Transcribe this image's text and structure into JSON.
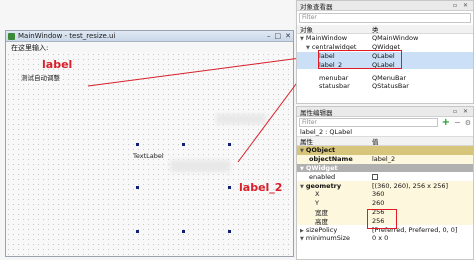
{
  "editor": {
    "window_title": "MainWindow - test_resize.ui",
    "menu_entry": "在这里输入:",
    "label_widget_text": "测试自动调整",
    "label2_widget_text": "TextLabel",
    "annotations": {
      "label": "label",
      "label_2": "label_2"
    },
    "annotation_color": "#d81f2a"
  },
  "object_inspector": {
    "title": "对象查看器",
    "filter_placeholder": "Filter",
    "columns": [
      "对象",
      "类"
    ],
    "rows": [
      {
        "object": "MainWindow",
        "class": "QMainWindow",
        "level": 0
      },
      {
        "object": "centralwidget",
        "class": "QWidget",
        "level": 1
      },
      {
        "object": "label",
        "class": "QLabel",
        "level": 2
      },
      {
        "object": "label_2",
        "class": "QLabel",
        "level": 2
      },
      {
        "object": "menubar",
        "class": "QMenuBar",
        "level": 1
      },
      {
        "object": "statusbar",
        "class": "QStatusBar",
        "level": 1
      }
    ]
  },
  "property_editor": {
    "title": "属性编辑器",
    "filter_placeholder": "Filter",
    "path": "label_2 : QLabel",
    "columns": [
      "属性",
      "值"
    ],
    "sections": {
      "qobject": "QObject",
      "qwidget": "QWidget"
    },
    "rows": {
      "objectName": {
        "name": "objectName",
        "value": "label_2"
      },
      "enabled": {
        "name": "enabled",
        "value": ""
      },
      "geometry": {
        "name": "geometry",
        "value": "[(360, 260), 256 x 256]"
      },
      "x": {
        "name": "X",
        "value": "360"
      },
      "y": {
        "name": "Y",
        "value": "260"
      },
      "width": {
        "name": "宽度",
        "value": "256"
      },
      "height": {
        "name": "高度",
        "value": "256"
      },
      "sizePolicy": {
        "name": "sizePolicy",
        "value": "[Preferred, Preferred, 0, 0]"
      },
      "minimumSize": {
        "name": "minimumSize",
        "value": "0 x 0"
      }
    }
  }
}
